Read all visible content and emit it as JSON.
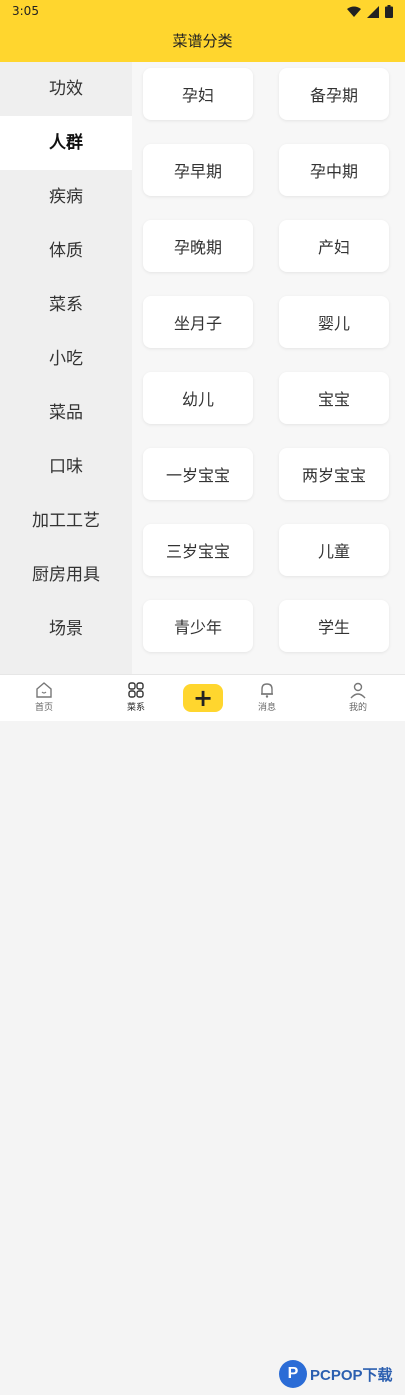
{
  "status_bar": {
    "time": "3:05"
  },
  "header": {
    "title": "菜谱分类"
  },
  "sidebar": {
    "items": [
      {
        "label": "功效"
      },
      {
        "label": "人群",
        "active": true
      },
      {
        "label": "疾病"
      },
      {
        "label": "体质"
      },
      {
        "label": "菜系"
      },
      {
        "label": "小吃"
      },
      {
        "label": "菜品"
      },
      {
        "label": "口味"
      },
      {
        "label": "加工工艺"
      },
      {
        "label": "厨房用具"
      },
      {
        "label": "场景"
      }
    ]
  },
  "categories": [
    "孕妇",
    "备孕期",
    "孕早期",
    "孕中期",
    "孕晚期",
    "产妇",
    "坐月子",
    "婴儿",
    "幼儿",
    "宝宝",
    "一岁宝宝",
    "两岁宝宝",
    "三岁宝宝",
    "儿童",
    "青少年",
    "学生"
  ],
  "bottom_nav": {
    "items": [
      {
        "label": "首页",
        "icon": "home-icon"
      },
      {
        "label": "菜系",
        "icon": "grid-icon",
        "active": true
      },
      {
        "label": "+",
        "icon": "plus-icon"
      },
      {
        "label": "消息",
        "icon": "bell-icon"
      },
      {
        "label": "我的",
        "icon": "user-icon"
      }
    ]
  },
  "watermark": {
    "logo_letter": "P",
    "text": "PCPOP下载"
  },
  "colors": {
    "accent": "#ffd62e",
    "watermark": "#2b6cd6"
  }
}
